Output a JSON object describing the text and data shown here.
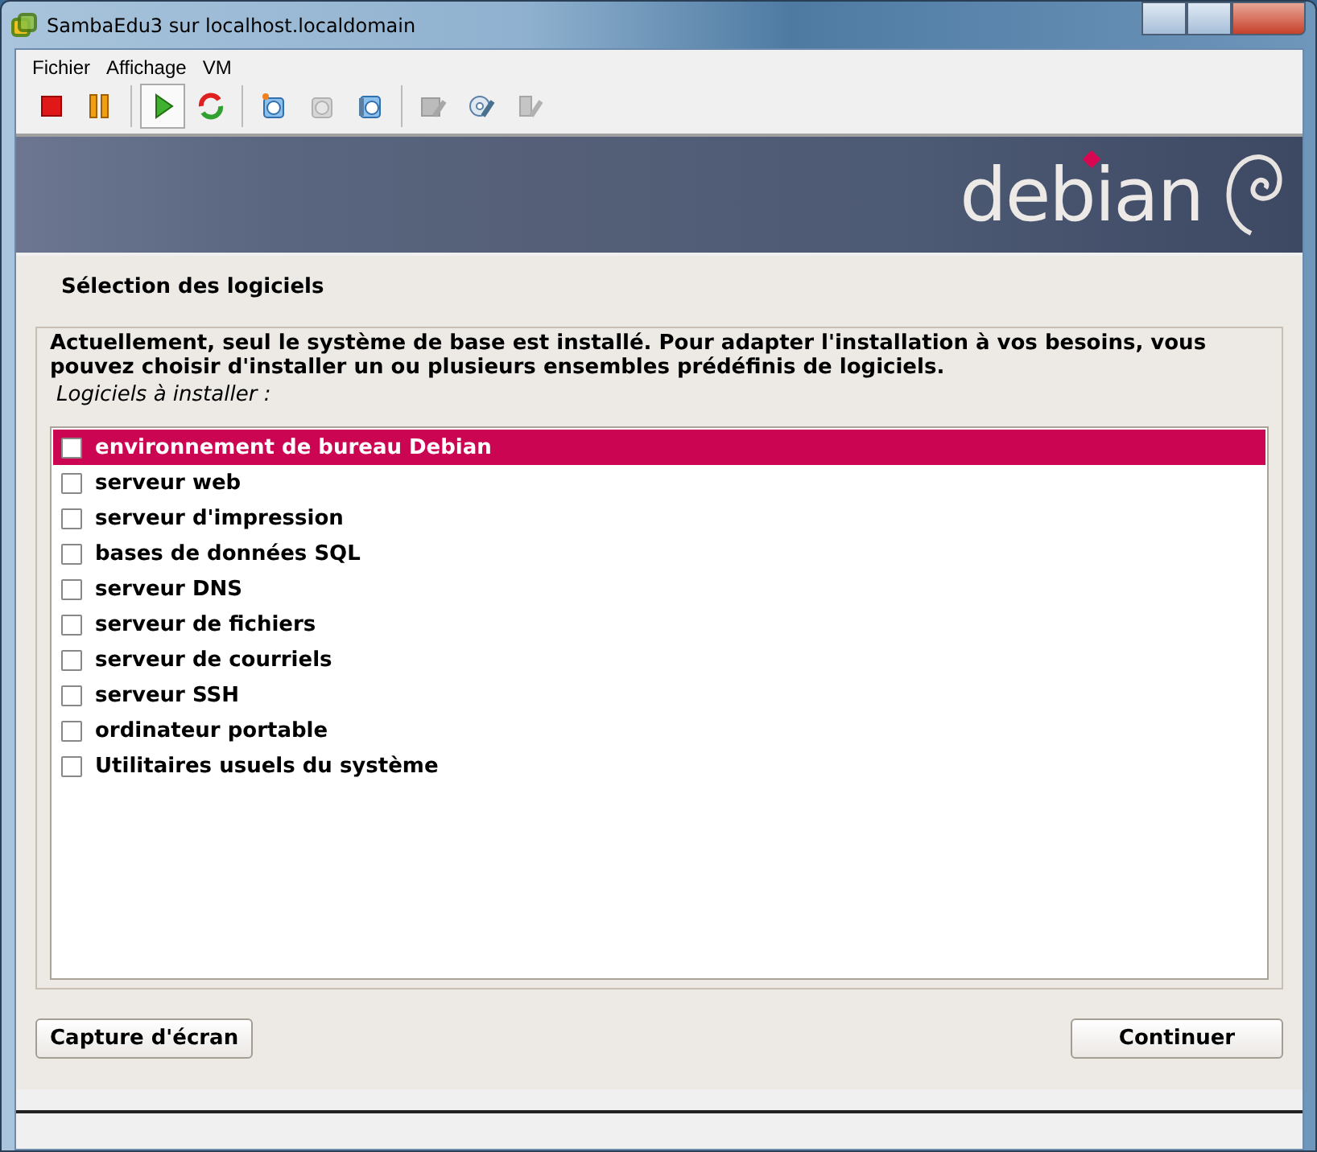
{
  "window": {
    "title": "SambaEdu3 sur localhost.localdomain"
  },
  "menu": [
    "Fichier",
    "Affichage",
    "VM"
  ],
  "toolbar": [
    {
      "kind": "stop",
      "pressed": false,
      "disabled": false
    },
    {
      "kind": "pause",
      "pressed": false,
      "disabled": false
    },
    {
      "kind": "play",
      "pressed": true,
      "disabled": false
    },
    {
      "kind": "reset",
      "pressed": false,
      "disabled": false
    },
    {
      "kind": "snapshot",
      "pressed": false,
      "disabled": false
    },
    {
      "kind": "revert",
      "pressed": false,
      "disabled": true
    },
    {
      "kind": "manager",
      "pressed": false,
      "disabled": false
    },
    {
      "kind": "floppy",
      "pressed": false,
      "disabled": true
    },
    {
      "kind": "cd",
      "pressed": false,
      "disabled": false
    },
    {
      "kind": "usb",
      "pressed": false,
      "disabled": true
    }
  ],
  "banner": {
    "logo": "debian"
  },
  "page": {
    "title": "Sélection des logiciels",
    "description": "Actuellement, seul le système de base est installé. Pour adapter l'installation à vos besoins, vous pouvez choisir d'installer un ou plusieurs ensembles prédéfinis de logiciels.",
    "list_label": "Logiciels à installer :",
    "items": [
      {
        "label": "environnement de bureau Debian",
        "checked": false,
        "selected": true
      },
      {
        "label": "serveur web",
        "checked": false,
        "selected": false
      },
      {
        "label": "serveur d'impression",
        "checked": false,
        "selected": false
      },
      {
        "label": "bases de données SQL",
        "checked": false,
        "selected": false
      },
      {
        "label": "serveur DNS",
        "checked": false,
        "selected": false
      },
      {
        "label": "serveur de fichiers",
        "checked": false,
        "selected": false
      },
      {
        "label": "serveur de courriels",
        "checked": false,
        "selected": false
      },
      {
        "label": "serveur SSH",
        "checked": false,
        "selected": false
      },
      {
        "label": "ordinateur portable",
        "checked": false,
        "selected": false
      },
      {
        "label": "Utilitaires usuels du système",
        "checked": false,
        "selected": false
      }
    ]
  },
  "buttons": [
    "Capture d'écran",
    "Continuer"
  ]
}
